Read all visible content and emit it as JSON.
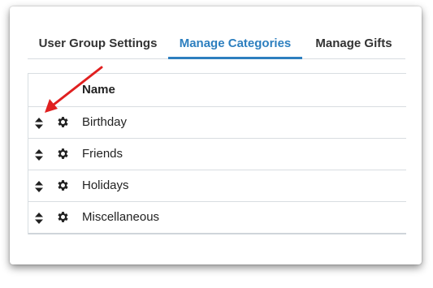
{
  "tabs": [
    {
      "label": "User Group Settings",
      "active": false
    },
    {
      "label": "Manage Categories",
      "active": true
    },
    {
      "label": "Manage Gifts",
      "active": false
    }
  ],
  "table": {
    "header": {
      "name": "Name"
    },
    "rows": [
      {
        "name": "Birthday"
      },
      {
        "name": "Friends"
      },
      {
        "name": "Holidays"
      },
      {
        "name": "Miscellaneous"
      }
    ]
  },
  "colors": {
    "active_tab": "#2d7fbf",
    "annotation_arrow": "#e02020"
  },
  "icons": {
    "row_handle": "sort-icon",
    "row_action": "gear-icon"
  }
}
